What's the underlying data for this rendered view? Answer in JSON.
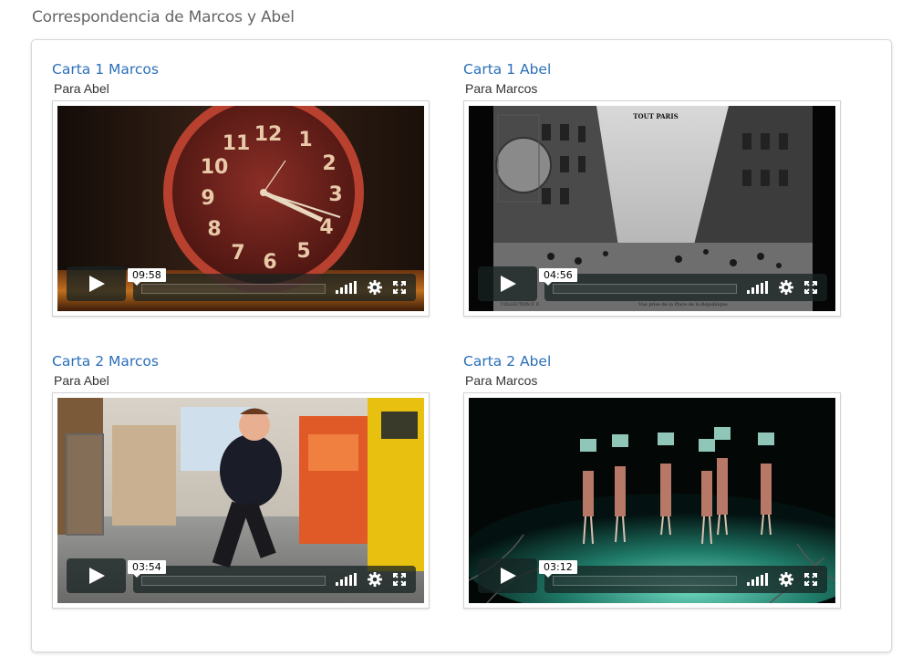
{
  "page": {
    "title": "Correspondencia de Marcos y Abel"
  },
  "videos": [
    {
      "title": "Carta 1 Marcos",
      "subtitle": "Para Abel",
      "duration": "09:58",
      "thumbnail": "clock"
    },
    {
      "title": "Carta 1 Abel",
      "subtitle": "Para Marcos",
      "duration": "04:56",
      "thumbnail": "paris-postcard"
    },
    {
      "title": "Carta 2 Marcos",
      "subtitle": "Para Abel",
      "duration": "03:54",
      "thumbnail": "child-cafe"
    },
    {
      "title": "Carta 2 Abel",
      "subtitle": "Para Marcos",
      "duration": "03:12",
      "thumbnail": "stage-dancers"
    }
  ],
  "postcard": {
    "header": "TOUT PARIS",
    "footer": "Vue prise de la Place de la République",
    "collection": "COLLECTION F. F."
  },
  "colors": {
    "link": "#2b6fb8",
    "controls_bg": "#172322"
  }
}
